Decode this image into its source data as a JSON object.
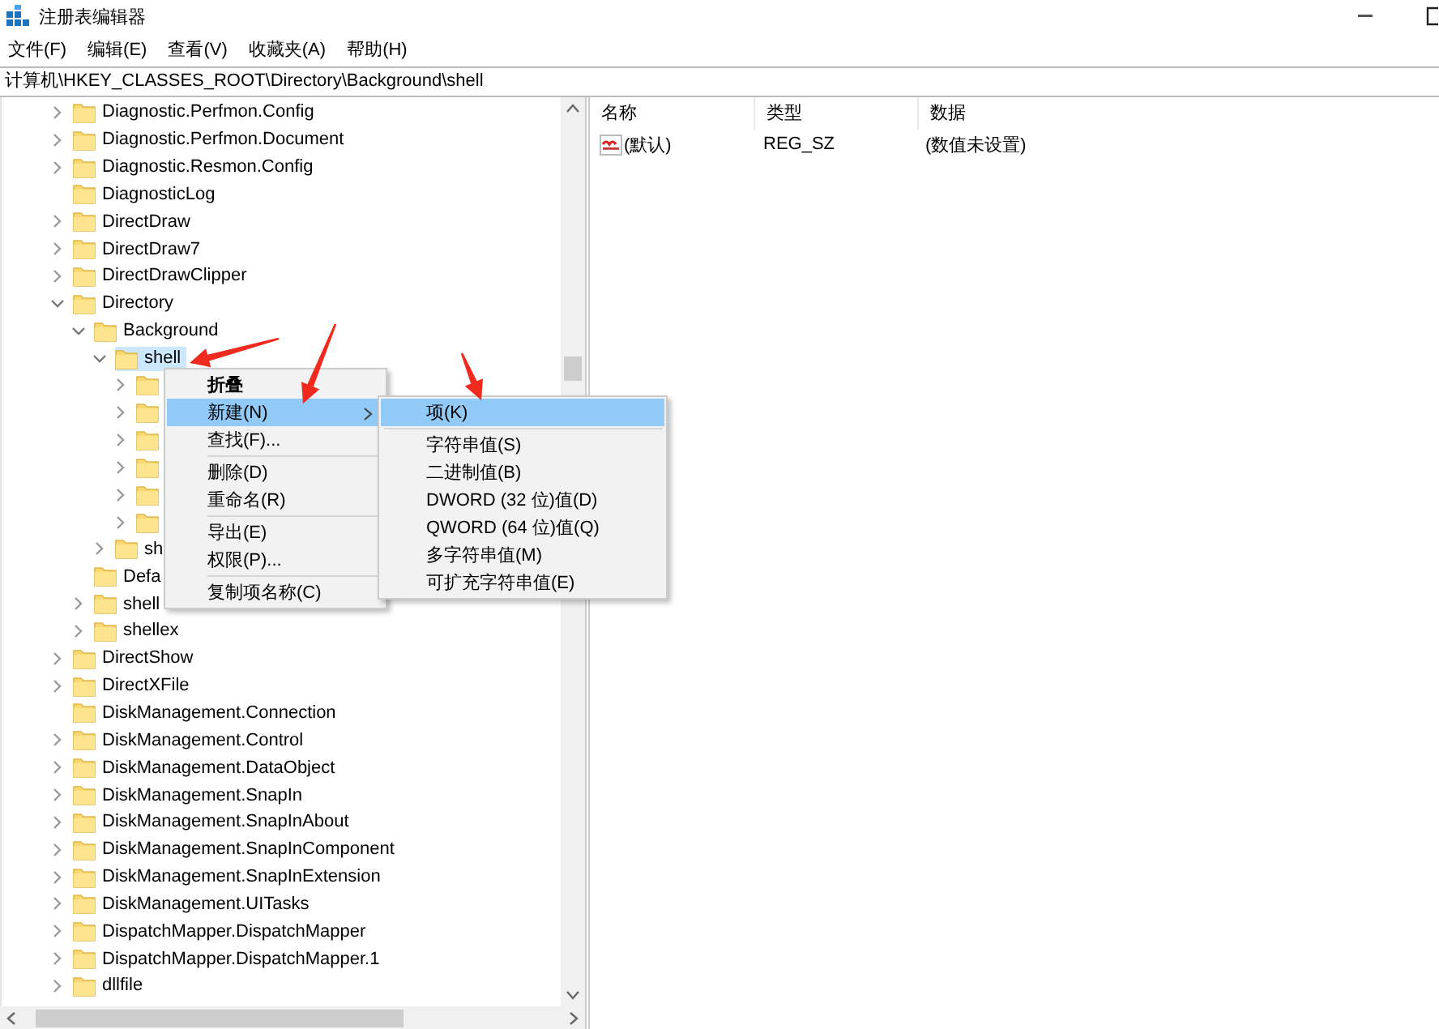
{
  "window": {
    "title": "注册表编辑器"
  },
  "menu_bar": [
    "文件(F)",
    "编辑(E)",
    "查看(V)",
    "收藏夹(A)",
    "帮助(H)"
  ],
  "address": "计算机\\HKEY_CLASSES_ROOT\\Directory\\Background\\shell",
  "tree": [
    {
      "label": "Diagnostic.Perfmon.Config",
      "expanded": false
    },
    {
      "label": "Diagnostic.Perfmon.Document",
      "expanded": false
    },
    {
      "label": "Diagnostic.Resmon.Config",
      "expanded": false
    },
    {
      "label": "DiagnosticLog"
    },
    {
      "label": "DirectDraw",
      "expanded": false
    },
    {
      "label": "DirectDraw7",
      "expanded": false
    },
    {
      "label": "DirectDrawClipper",
      "expanded": false
    },
    {
      "label": "Directory",
      "expanded": true,
      "children": [
        {
          "label": "Background",
          "expanded": true,
          "children": [
            {
              "label": "shell",
              "expanded": true,
              "selected": true,
              "children": [
                {
                  "expanded": false
                },
                {
                  "expanded": false
                },
                {
                  "expanded": false
                },
                {
                  "expanded": false
                },
                {
                  "expanded": false
                },
                {
                  "expanded": false
                }
              ]
            },
            {
              "label": "sh",
              "expanded": false
            }
          ]
        },
        {
          "label": "Defa"
        },
        {
          "label": "shell",
          "expanded": false
        },
        {
          "label": "shellex",
          "expanded": false
        }
      ]
    },
    {
      "label": "DirectShow",
      "expanded": false
    },
    {
      "label": "DirectXFile",
      "expanded": false
    },
    {
      "label": "DiskManagement.Connection"
    },
    {
      "label": "DiskManagement.Control",
      "expanded": false
    },
    {
      "label": "DiskManagement.DataObject",
      "expanded": false
    },
    {
      "label": "DiskManagement.SnapIn",
      "expanded": false
    },
    {
      "label": "DiskManagement.SnapInAbout",
      "expanded": false
    },
    {
      "label": "DiskManagement.SnapInComponent",
      "expanded": false
    },
    {
      "label": "DiskManagement.SnapInExtension",
      "expanded": false
    },
    {
      "label": "DiskManagement.UITasks",
      "expanded": false
    },
    {
      "label": "DispatchMapper.DispatchMapper",
      "expanded": false
    },
    {
      "label": "DispatchMapper.DispatchMapper.1",
      "expanded": false
    },
    {
      "label": "dllfile",
      "expanded": false
    }
  ],
  "values": {
    "columns": [
      "名称",
      "类型",
      "数据"
    ],
    "rows": [
      {
        "name": "(默认)",
        "type": "REG_SZ",
        "data": "(数值未设置)"
      }
    ]
  },
  "context_menu": [
    {
      "kind": "item",
      "label": "折叠",
      "default": true,
      "selected": false
    },
    {
      "kind": "item",
      "label": "新建(N)",
      "selected": true,
      "submenu": true
    },
    {
      "kind": "item",
      "label": "查找(F)...",
      "selected": false
    },
    {
      "kind": "separator"
    },
    {
      "kind": "item",
      "label": "删除(D)",
      "selected": false
    },
    {
      "kind": "item",
      "label": "重命名(R)",
      "selected": false
    },
    {
      "kind": "separator"
    },
    {
      "kind": "item",
      "label": "导出(E)",
      "selected": false
    },
    {
      "kind": "item",
      "label": "权限(P)...",
      "selected": false
    },
    {
      "kind": "separator"
    },
    {
      "kind": "item",
      "label": "复制项名称(C)",
      "selected": false
    }
  ],
  "submenu": [
    {
      "kind": "item",
      "label": "项(K)",
      "selected": true
    },
    {
      "kind": "separator"
    },
    {
      "kind": "item",
      "label": "字符串值(S)",
      "selected": false
    },
    {
      "kind": "item",
      "label": "二进制值(B)",
      "selected": false
    },
    {
      "kind": "item",
      "label": "DWORD (32 位)值(D)",
      "selected": false
    },
    {
      "kind": "item",
      "label": "QWORD (64 位)值(Q)",
      "selected": false
    },
    {
      "kind": "item",
      "label": "多字符串值(M)",
      "selected": false
    },
    {
      "kind": "item",
      "label": "可扩充字符串值(E)",
      "selected": false
    }
  ]
}
